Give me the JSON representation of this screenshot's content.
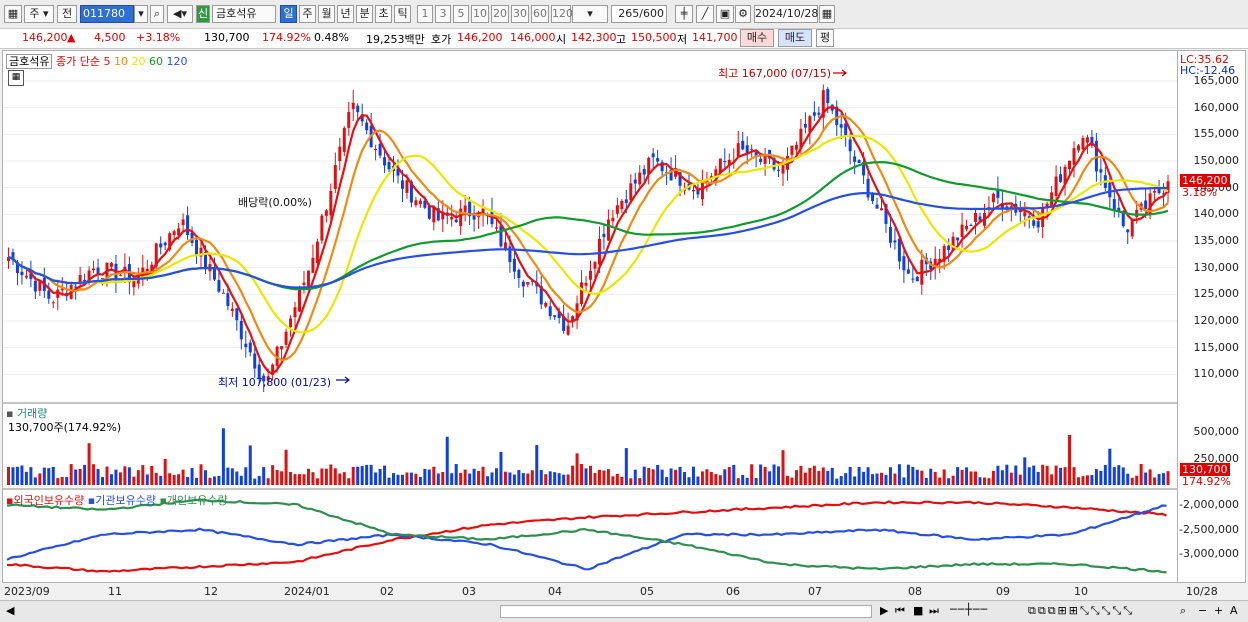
{
  "toolbar": {
    "period_unit": "주",
    "prev_label": "전",
    "code": "011780",
    "stock_badge": "신",
    "stock_name": "금호석유",
    "tabs": [
      "일",
      "주",
      "월",
      "년",
      "분",
      "초",
      "틱"
    ],
    "num_tabs": [
      "1",
      "3",
      "5",
      "10",
      "20",
      "30",
      "60",
      "120"
    ],
    "count": "265",
    "count_total": "/600",
    "date": "2024/10/28"
  },
  "quote": {
    "price": "146,200",
    "change": "4,500",
    "change_pct": "+3.18%",
    "volume": "130,700",
    "volume_ratio": "174.92%",
    "turnover": "0.48%",
    "amount": "19,253백만",
    "hoga_label": "호가",
    "hoga1": "146,200",
    "hoga2": "146,000",
    "open_label": "시",
    "open": "142,300",
    "high_label": "고",
    "high": "150,500",
    "low_label": "저",
    "low": "141,700",
    "buy": "매수",
    "sell": "매도",
    "eval": "평"
  },
  "price_panel": {
    "name": "금호석유",
    "ma_label": "종가 단순",
    "ma_periods": [
      "5",
      "10",
      "20",
      "60",
      "120"
    ],
    "ma_colors": [
      "#e81010",
      "#f08a10",
      "#e8e800",
      "#109a30",
      "#2850e0"
    ],
    "lc": "LC:35.62",
    "hc": "HC:-12.46",
    "y_ticks": [
      "165,000",
      "160,000",
      "155,000",
      "150,000",
      "145,000",
      "140,000",
      "135,000",
      "130,000",
      "125,000",
      "120,000",
      "115,000",
      "110,000"
    ],
    "current_tag": "146,200",
    "current_pct": "3.18%",
    "high_ann": "최고 167,000 (07/15)",
    "low_ann": "최저 107,800 (01/23)",
    "div_ann": "배당락(0.00%)"
  },
  "volume_panel": {
    "title": "거래량",
    "value": "130,700주(174.92%)",
    "y_ticks": [
      "500,000",
      "250,000"
    ],
    "current_tag": "130,700",
    "current_pct": "174.92%"
  },
  "holding_panel": {
    "legend": [
      "외국인보유수량",
      "기관보유수량",
      "개인보유수량"
    ],
    "colors": [
      "#e01010",
      "#2850e0",
      "#2f8f4f"
    ],
    "y_ticks": [
      "-2,000,000",
      "-2,500,000",
      "-3,000,000"
    ]
  },
  "x_axis": [
    "2023/09",
    "11",
    "12",
    "2024/01",
    "02",
    "03",
    "04",
    "05",
    "06",
    "07",
    "08",
    "09",
    "10",
    "10/28"
  ],
  "chart_data": {
    "type": "line",
    "title": "금호석유",
    "xlabel": "",
    "ylabel": "",
    "x": [
      "2023/09",
      "11",
      "12",
      "2024/01",
      "02",
      "03",
      "04",
      "05",
      "06",
      "07",
      "08",
      "09",
      "10",
      "10/28"
    ],
    "ylim": [
      105000,
      168000
    ],
    "close_series": [
      132000,
      124000,
      130000,
      128000,
      139000,
      125000,
      108000,
      130000,
      160000,
      147000,
      139000,
      141000,
      128000,
      119000,
      140000,
      150000,
      145000,
      152000,
      148000,
      162000,
      145000,
      128000,
      135000,
      143000,
      139000,
      156000,
      137000,
      146200
    ],
    "highs": [
      {
        "label": "최고",
        "value": 167000,
        "date": "07/15"
      },
      {
        "label": "최저",
        "value": 107800,
        "date": "01/23"
      }
    ],
    "volume_ylim": [
      0,
      700000
    ],
    "holding_ylim": [
      -3500000,
      -1800000
    ]
  }
}
